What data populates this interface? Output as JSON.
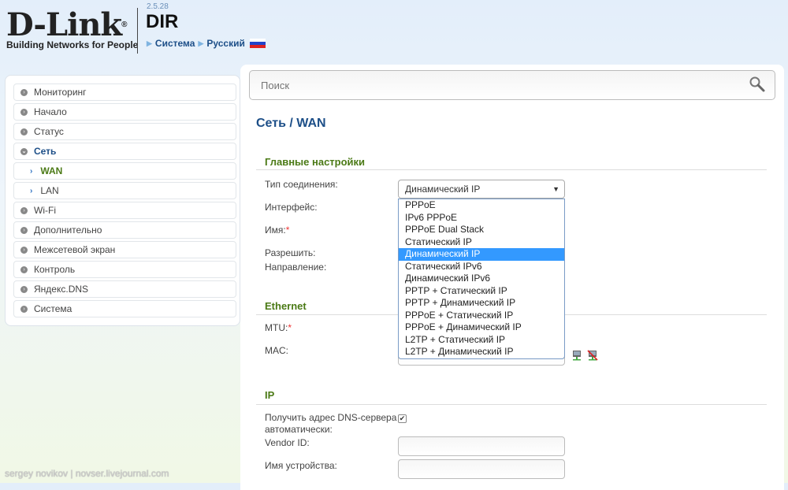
{
  "header": {
    "logo": "D-Link",
    "tagline": "Building Networks for People",
    "version": "2.5.28",
    "model": "DIR",
    "crumbs": [
      "Система",
      "Русский"
    ]
  },
  "sidebar": {
    "items": [
      {
        "label": "Мониторинг"
      },
      {
        "label": "Начало"
      },
      {
        "label": "Статус"
      },
      {
        "label": "Сеть"
      },
      {
        "label": "WAN"
      },
      {
        "label": "LAN"
      },
      {
        "label": "Wi-Fi"
      },
      {
        "label": "Дополнительно"
      },
      {
        "label": "Межсетевой экран"
      },
      {
        "label": "Контроль"
      },
      {
        "label": "Яндекс.DNS"
      },
      {
        "label": "Система"
      }
    ]
  },
  "search": {
    "placeholder": "Поиск"
  },
  "page": {
    "title": "Сеть /  WAN"
  },
  "main_settings": {
    "heading": "Главные настройки",
    "conn_type_label": "Тип соединения:",
    "conn_type_value": "Динамический IP",
    "interface_label": "Интерфейс:",
    "name_label": "Имя:",
    "allow_label": "Разрешить:",
    "direction_label": "Направление:",
    "options": [
      "PPPoE",
      "IPv6 PPPoE",
      "PPPoE Dual Stack",
      "Статический IP",
      "Динамический IP",
      "Статический IPv6",
      "Динамический IPv6",
      "PPTP + Статический IP",
      "PPTP + Динамический IP",
      "PPPoE + Статический IP",
      "PPPoE + Динамический IP",
      "L2TP + Статический IP",
      "L2TP + Динамический IP"
    ],
    "selected_index": 4
  },
  "ethernet": {
    "heading": "Ethernet",
    "mtu_label": "MTU:",
    "mac_label": "MAC:"
  },
  "ip": {
    "heading": "IP",
    "dns_auto_label_1": "Получить адрес DNS-сервера",
    "dns_auto_label_2": "автоматически:",
    "dns_auto_checked": true,
    "vendor_label": "Vendor ID:",
    "device_name_label": "Имя устройства:"
  },
  "required_mark": "*",
  "watermark": "sergey novikov | novser.livejournal.com"
}
